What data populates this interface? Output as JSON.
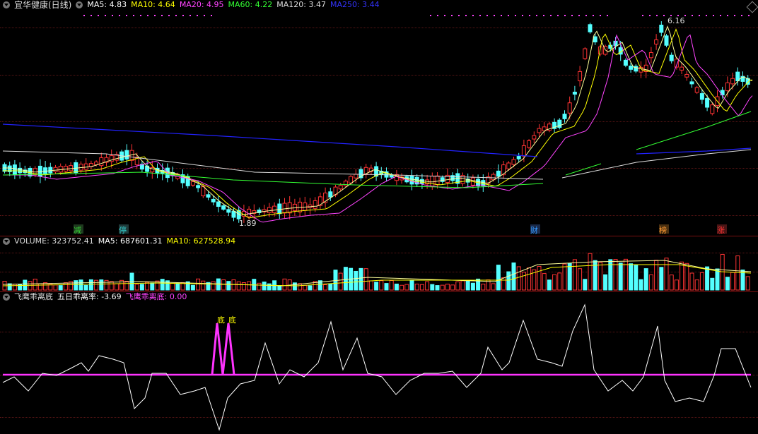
{
  "main_header": {
    "stock_title": "宜华健康(日线)",
    "ma5": "MA5: 4.83",
    "ma10": "MA10: 4.64",
    "ma20": "MA20: 4.95",
    "ma60": "MA60: 4.22",
    "ma120": "MA120: 3.47",
    "ma250": "MA250: 3.44"
  },
  "price_annotations": {
    "high": "6.16",
    "low": "1.89"
  },
  "event_markers": [
    {
      "label": "减",
      "color": "#33cc33"
    },
    {
      "label": "停",
      "color": "#33cccc"
    },
    {
      "label": "财",
      "color": "#3399ff"
    },
    {
      "label": "榜",
      "color": "#ff9933"
    },
    {
      "label": "涨",
      "color": "#ff3333"
    }
  ],
  "volume_header": {
    "title": "VOLUME: 323752.41",
    "ma5": "MA5: 687601.31",
    "ma10": "MA10: 627528.94"
  },
  "indicator_header": {
    "title": "飞鹰乖离底",
    "deviation": "五日乖离率: -3.69",
    "signal": "飞鹰乖离底: 0.00"
  },
  "indicator_annotations": {
    "bottom_a": "底",
    "bottom_b": "底"
  },
  "colors": {
    "up": "#ff3333",
    "down": "#54ffff",
    "ma5": "#ffff99",
    "ma10": "#ffff00",
    "ma20": "#ff44ff",
    "ma60": "#33ff33",
    "ma120": "#dddddd",
    "ma250": "#2222ff",
    "signal": "#ff33ff"
  }
}
